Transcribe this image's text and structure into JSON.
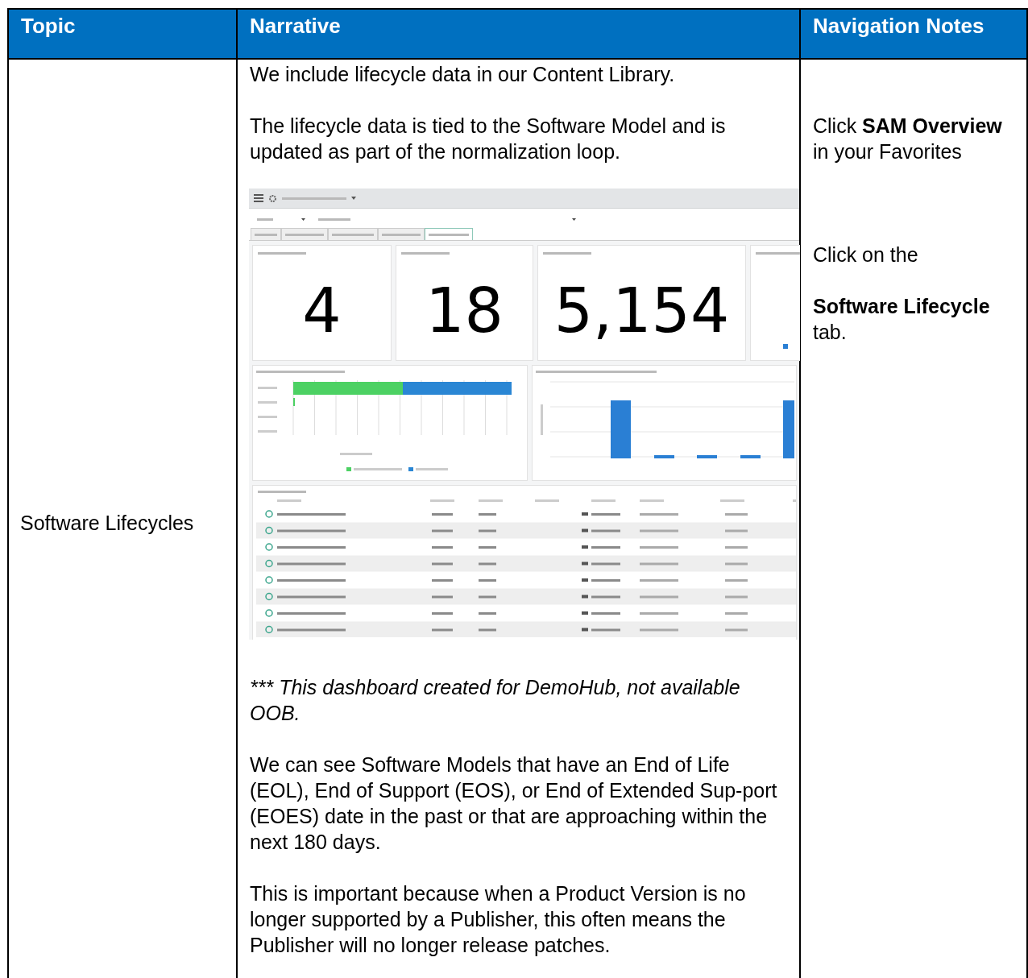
{
  "table": {
    "columns": [
      "Topic",
      "Narrative",
      "Navigation Notes"
    ],
    "rows": [
      {
        "topic": "Software Lifecycles",
        "narrative": [
          {
            "kind": "text",
            "text": "We include lifecycle data in our Content Library."
          },
          {
            "kind": "text",
            "text": "The lifecycle data is tied to the Software Model and is updated as part of the normalization loop."
          },
          {
            "kind": "screenshot",
            "metrics": [
              "4",
              "18",
              "5,154"
            ],
            "tabs": [
              {
                "selected": false
              },
              {
                "selected": false
              },
              {
                "selected": false
              },
              {
                "selected": false
              },
              {
                "selected": true
              }
            ]
          },
          {
            "kind": "note",
            "text": "*** This dashboard created for DemoHub, not available OOB."
          },
          {
            "kind": "text",
            "text": "We can see Software Models that have an End of Life (EOL), End of Support (EOS), or End of Extended Sup-port (EOES) date in the past or that are approaching within the next 180 days."
          },
          {
            "kind": "text",
            "text": "This is important because when a Product Version is no longer supported by a Publisher, this often means the Publisher will no longer release patches."
          }
        ],
        "navigation": [
          "Click **SAM Overview** in your Favorites",
          "Click on the",
          "**Software Lifecycle** tab."
        ]
      }
    ]
  }
}
